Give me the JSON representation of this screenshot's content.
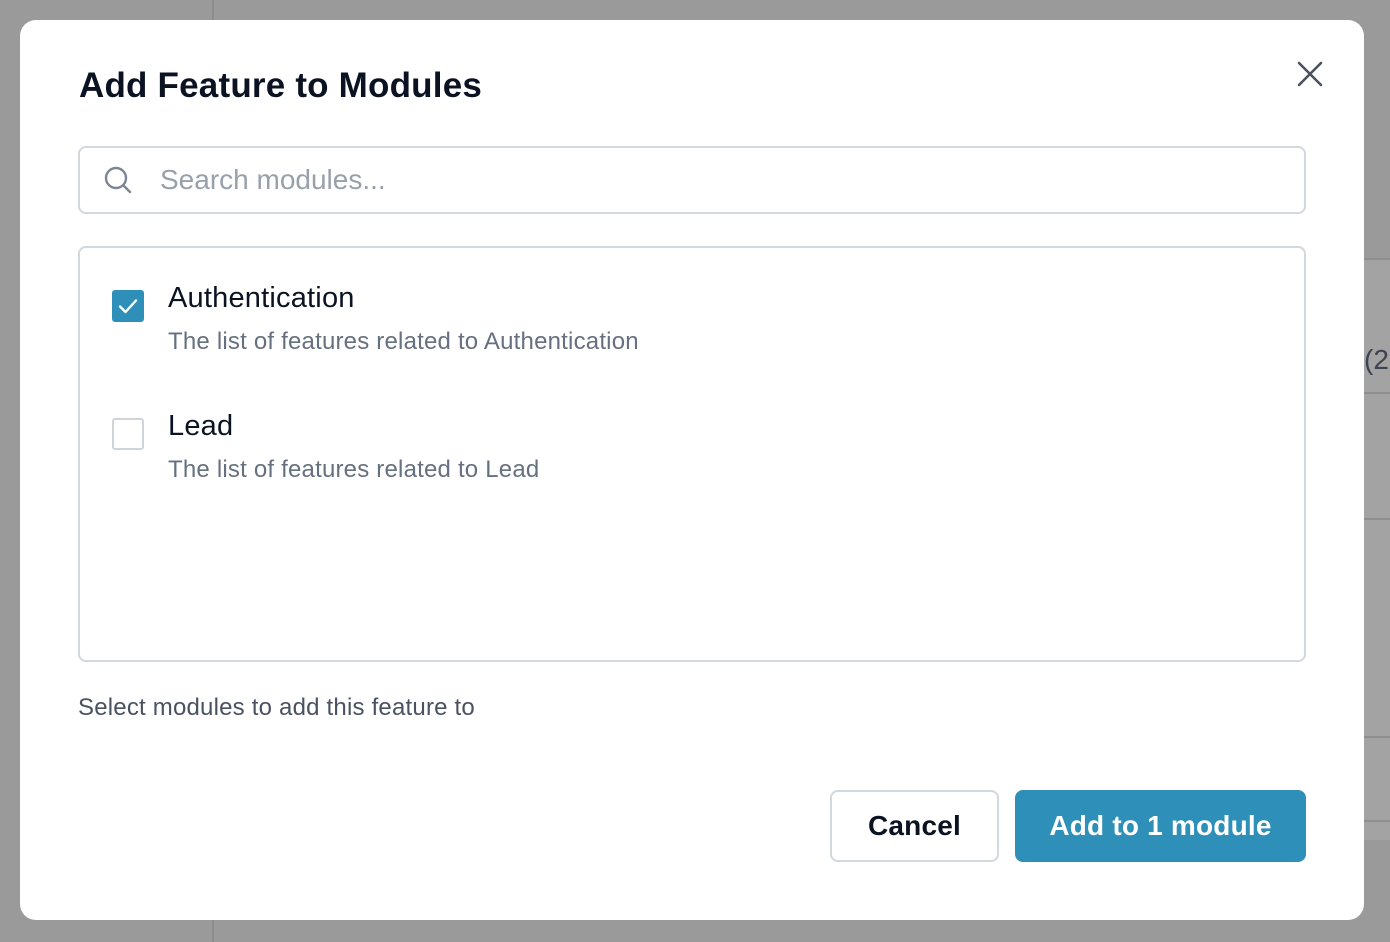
{
  "background": {
    "partial_text": "(2"
  },
  "modal": {
    "title": "Add Feature to Modules",
    "close_icon": "close-icon"
  },
  "search": {
    "placeholder": "Search modules...",
    "value": "",
    "icon": "search-icon"
  },
  "modules": [
    {
      "name": "Authentication",
      "description": "The list of features related to Authentication",
      "checked": true
    },
    {
      "name": "Lead",
      "description": "The list of features related to Lead",
      "checked": false
    }
  ],
  "helper_text": "Select modules to add this feature to",
  "actions": {
    "cancel_label": "Cancel",
    "submit_label": "Add to 1 module"
  },
  "colors": {
    "accent": "#2e8fb8",
    "border": "#d3d7de",
    "overlay": "#9a9a9a"
  }
}
